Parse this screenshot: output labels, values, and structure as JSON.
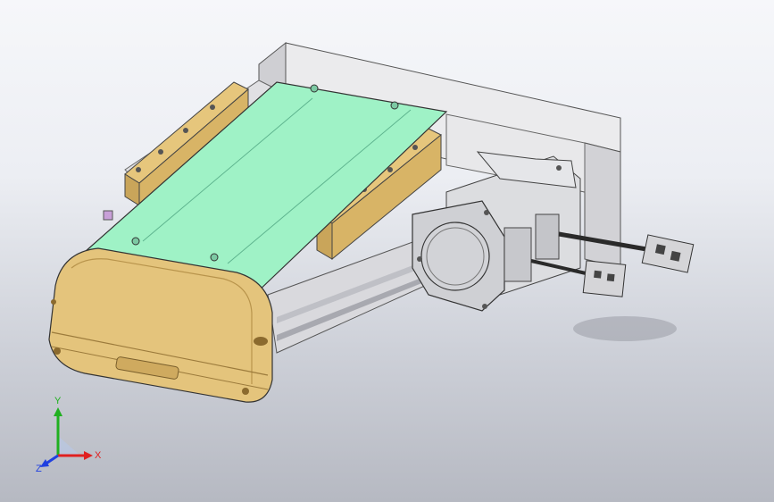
{
  "triad": {
    "x_label": "X",
    "y_label": "Y",
    "z_label": "Z",
    "x_color": "#e02020",
    "y_color": "#20b020",
    "z_color": "#2040e0"
  },
  "model": {
    "carriage_color": "#9ef0c8",
    "end_cap_color": "#e2c17a",
    "rail_block_color": "#d8ba70",
    "frame_color": "#e4e4e6",
    "motor_color": "#d9dadd",
    "cable_color": "#2a2a2a",
    "connector_color": "#d0d0d0"
  }
}
